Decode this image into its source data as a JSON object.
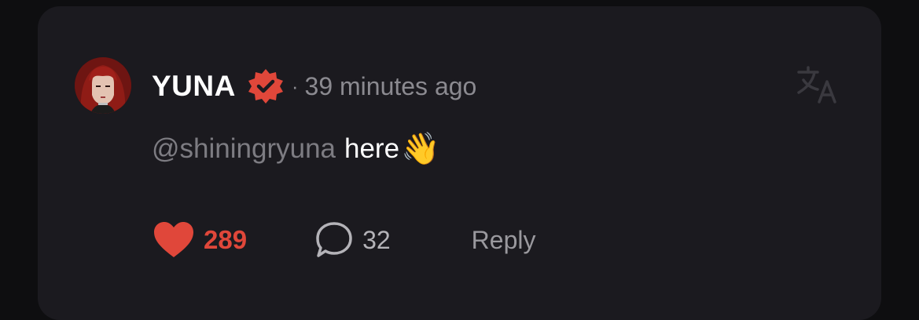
{
  "comment": {
    "username": "YUNA",
    "time_separator": "·",
    "timestamp": "39 minutes ago",
    "mention": "@shiningryuna",
    "text": "here",
    "emoji": "👋",
    "likes": "289",
    "comments": "32",
    "reply_label": "Reply"
  },
  "colors": {
    "background": "#0e0e10",
    "card": "#1b1a1f",
    "verified_badge": "#e0473a",
    "like": "#e0473a",
    "muted_text": "#8b8a90"
  },
  "icons": {
    "verified": "verified-badge-icon",
    "translate": "translate-icon",
    "like": "heart-icon",
    "comment": "comment-bubble-icon"
  }
}
